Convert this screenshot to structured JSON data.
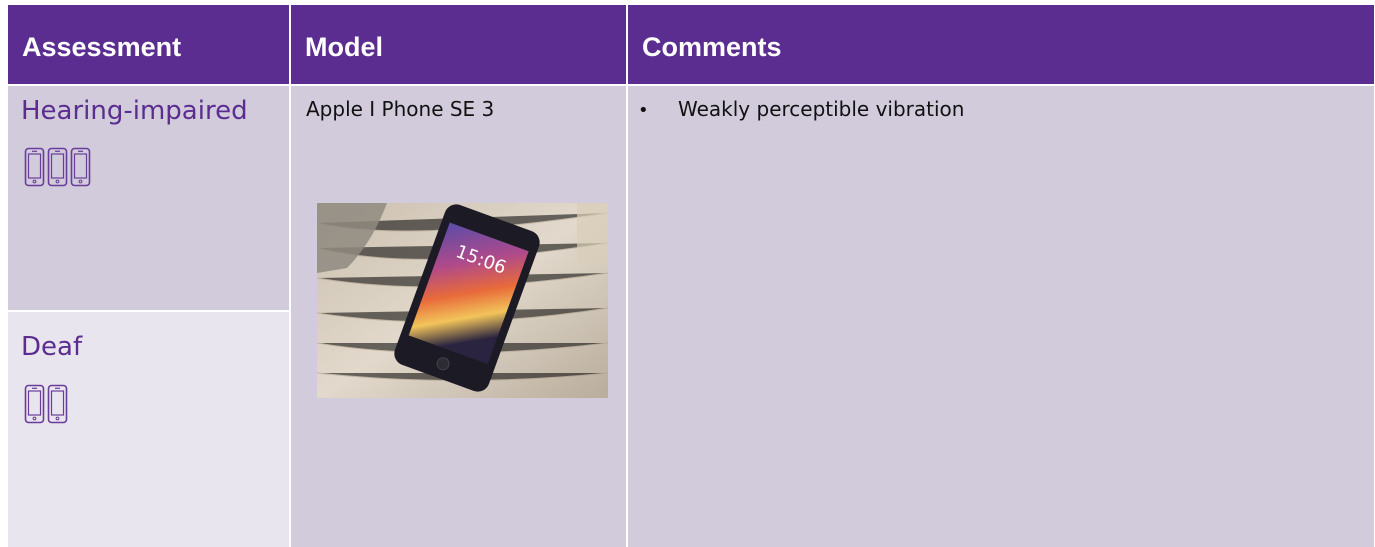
{
  "table": {
    "headers": {
      "assessment": "Assessment",
      "model": "Model",
      "comments": "Comments"
    },
    "rows": [
      {
        "assessment": "Hearing-impaired",
        "phone_icon_count": 3,
        "icon": "phone-vibrate-icon"
      },
      {
        "assessment": "Deaf",
        "phone_icon_count": 2,
        "icon": "phone-vibrate-icon"
      }
    ],
    "model": {
      "name": "Apple I Phone SE 3",
      "photo_label": "iPhone SE 3 lock screen photo",
      "lock_time": "15:06"
    },
    "comments": {
      "bullet_glyph": "•",
      "items": [
        "Weakly perceptible vibration"
      ]
    }
  },
  "colors": {
    "header_bg": "#5b2d90",
    "header_text": "#ffffff",
    "cell_bg": "#d1cbdc",
    "cell_bg_light": "#e8e5ee",
    "accent_text": "#5b2d90"
  }
}
